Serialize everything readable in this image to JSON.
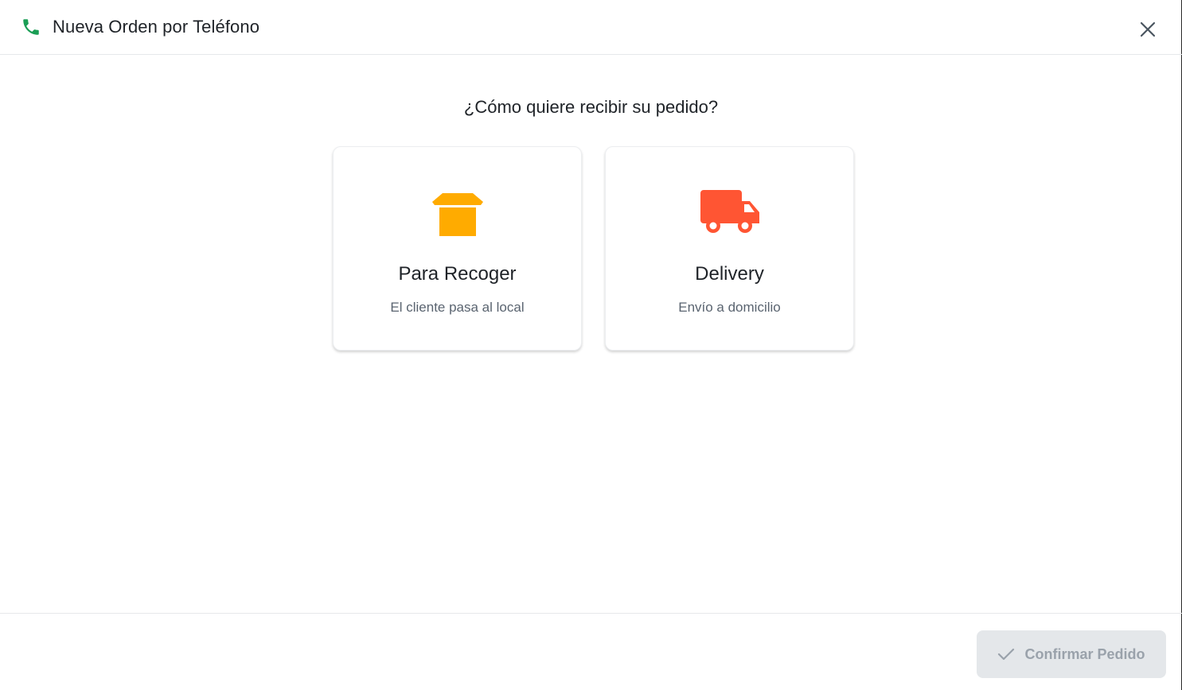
{
  "header": {
    "title": "Nueva Orden por Teléfono",
    "icon": "phone-icon",
    "close_icon": "close-icon",
    "accent_color": "#1a9e55"
  },
  "main": {
    "question": "¿Cómo quiere recibir su pedido?",
    "options": [
      {
        "title": "Para Recoger",
        "subtitle": "El cliente pasa al local",
        "icon": "takeout-box-icon",
        "icon_color": "#ffab00"
      },
      {
        "title": "Delivery",
        "subtitle": "Envío a domicilio",
        "icon": "delivery-truck-icon",
        "icon_color": "#ff5533"
      }
    ]
  },
  "footer": {
    "confirm_label": "Confirmar Pedido",
    "confirm_icon": "check-icon",
    "confirm_disabled": true
  }
}
